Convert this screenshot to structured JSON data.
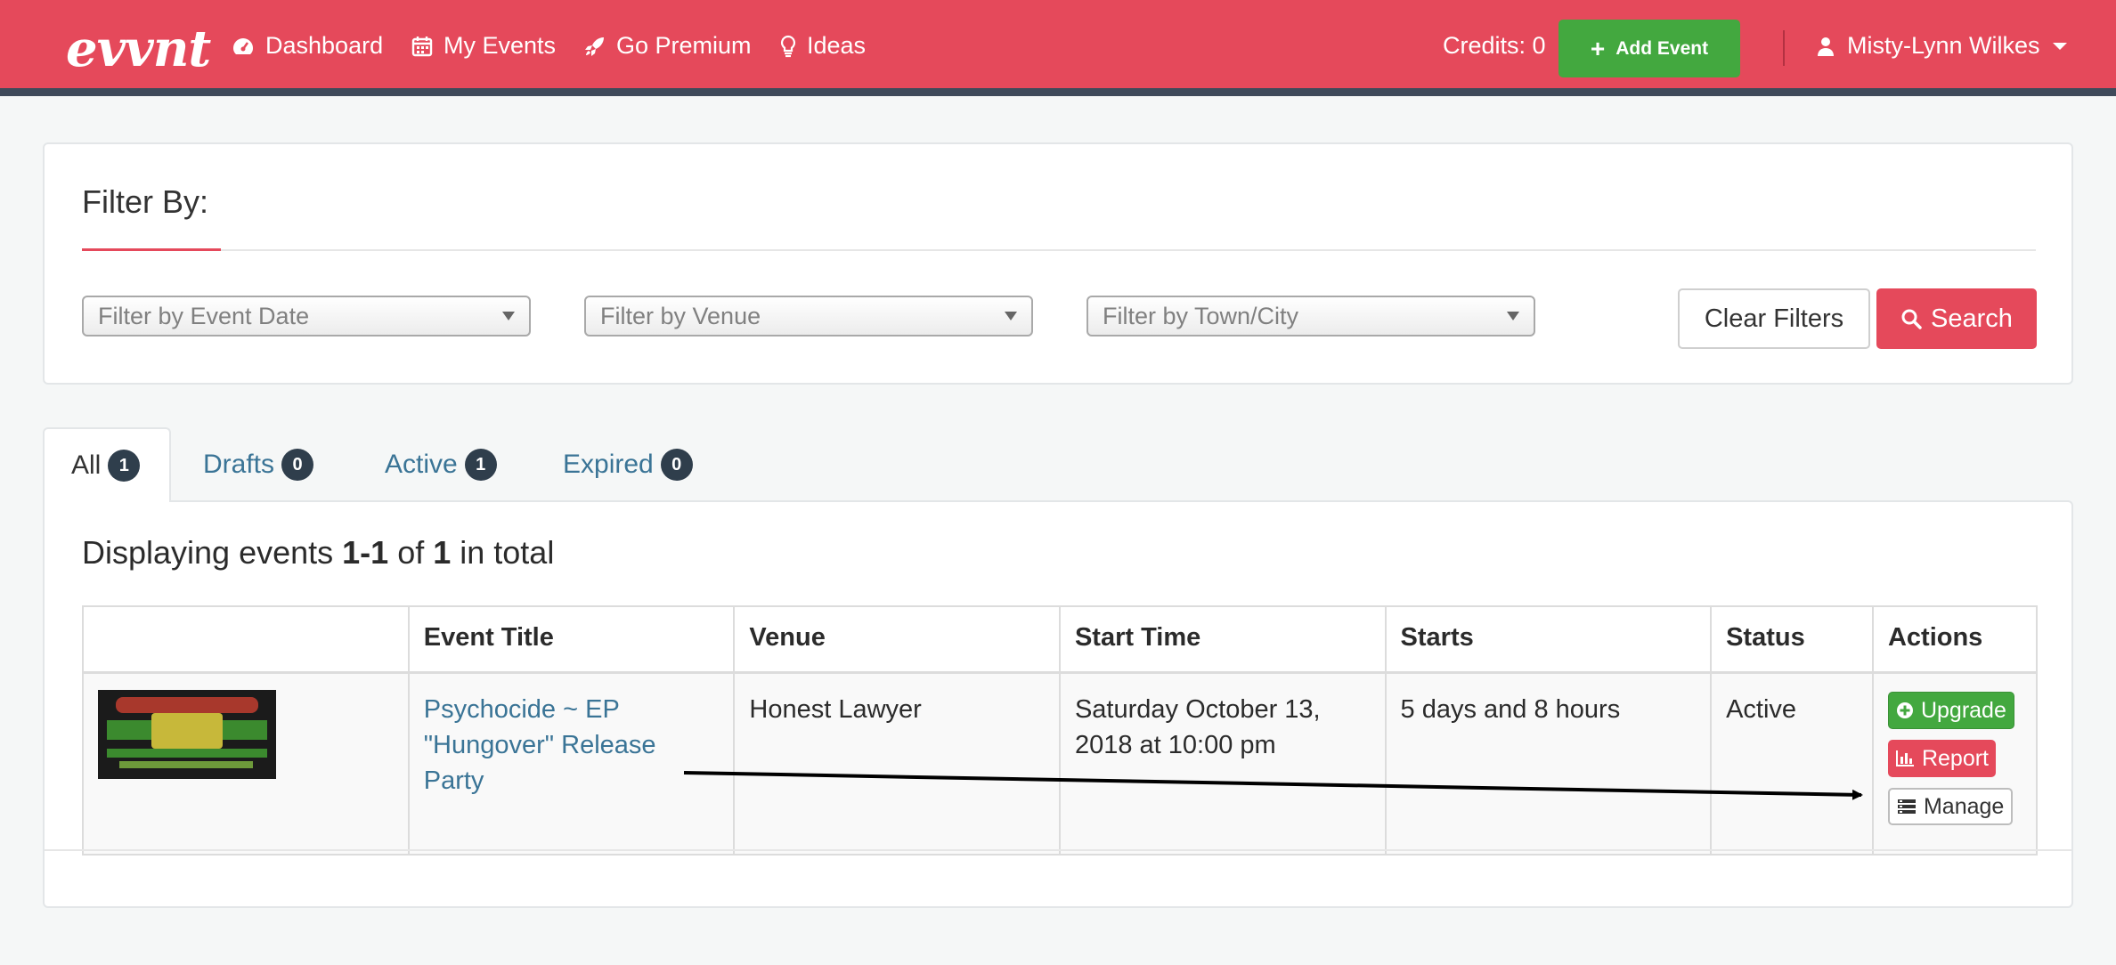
{
  "navbar": {
    "brand": "evvnt",
    "links": [
      {
        "label": "Dashboard",
        "icon": "dashboard-icon"
      },
      {
        "label": "My Events",
        "icon": "calendar-icon"
      },
      {
        "label": "Go Premium",
        "icon": "rocket-icon"
      },
      {
        "label": "Ideas",
        "icon": "lightbulb-icon"
      }
    ],
    "credits": "Credits: 0",
    "add_event": "Add Event",
    "user_name": "Misty-Lynn Wilkes"
  },
  "filter": {
    "title": "Filter By:",
    "event_date_placeholder": "Filter by Event Date",
    "venue_placeholder": "Filter by Venue",
    "town_placeholder": "Filter by Town/City",
    "clear_label": "Clear Filters",
    "search_label": "Search"
  },
  "tabs": [
    {
      "label": "All",
      "count": "1"
    },
    {
      "label": "Drafts",
      "count": "0"
    },
    {
      "label": "Active",
      "count": "1"
    },
    {
      "label": "Expired",
      "count": "0"
    }
  ],
  "events": {
    "display_prefix": "Displaying events ",
    "display_range": "1-1",
    "display_of": " of ",
    "display_total": "1",
    "display_suffix": " in total",
    "columns": [
      "",
      "Event Title",
      "Venue",
      "Start Time",
      "Starts",
      "Status",
      "Actions"
    ],
    "rows": [
      {
        "title": "Psychocide ~ EP \"Hungover\" Release Party",
        "venue": "Honest Lawyer",
        "start_time": "Saturday October 13, 2018 at 10:00 pm",
        "starts": "5 days and 8 hours",
        "status": "Active",
        "actions": {
          "upgrade": "Upgrade",
          "report": "Report",
          "manage": "Manage"
        }
      }
    ]
  },
  "colors": {
    "brand": "#e5495b",
    "success": "#43a83f",
    "link": "#3a7496",
    "navbar_border": "#3f4a5a"
  }
}
